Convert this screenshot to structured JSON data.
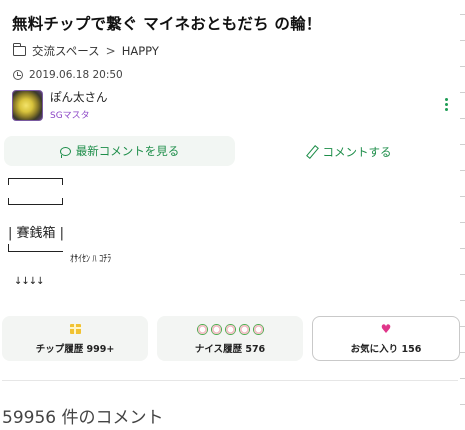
{
  "post": {
    "title": "無料チップで繋ぐ マイネおともだち の輪！",
    "breadcrumb": {
      "category": "交流スペース",
      "separator": ">",
      "tag": "HAPPY"
    },
    "date": "2019.06.18 20:50",
    "author": {
      "name": "ぽん太さん",
      "role": "SGマスタ"
    },
    "body": {
      "saisen": "| 賽銭箱 |",
      "line_text": "ｵｻｲｾﾝ ﾊ ｺﾁﾗ",
      "arrows": "↓↓↓↓"
    }
  },
  "actions": {
    "latest_comments": "最新コメントを見る",
    "write_comment": "コメントする"
  },
  "stats": {
    "tip_history": "チップ履歴 999+",
    "nice_history": "ナイス履歴 576",
    "favorites": "お気に入り 156"
  },
  "comments": {
    "count_number": "59956",
    "count_suffix": " 件のコメント"
  },
  "colors": {
    "accent_green": "#1e8e4a",
    "role_purple": "#8b45c5",
    "heart_pink": "#e0368a",
    "gift_yellow": "#f1c232"
  },
  "icons": [
    "folder-icon",
    "clock-icon",
    "more-vert-icon",
    "comment-bubble-icon",
    "pencil-icon",
    "gift-icon",
    "nice-flower-icon",
    "heart-icon"
  ]
}
